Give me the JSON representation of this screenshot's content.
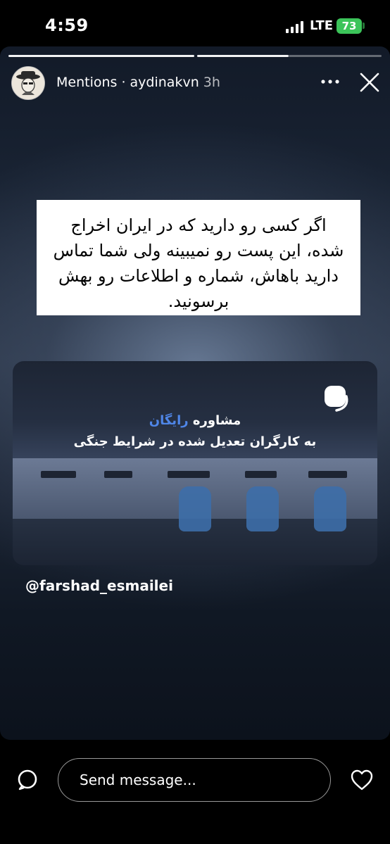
{
  "status_bar": {
    "time": "4:59",
    "network": "LTE",
    "battery": "73"
  },
  "story": {
    "header": {
      "label": "Mentions · aydinakvn",
      "time": "3h"
    },
    "text_card": {
      "text": "اگر کسی رو دارید که در ایران اخراج شده، این پست رو نمیبینه ولی شما تماس دارید باهاش، شماره و اطلاعات رو بهش برسونید."
    },
    "media_card": {
      "line1_prefix": "مشاوره ",
      "line1_highlight": "رایگان",
      "line2": "به کارگران تعدیل شده در شرایط جنگی"
    },
    "mention": "@farshad_esmailei"
  },
  "reply_bar": {
    "placeholder": "Send message..."
  },
  "colors": {
    "battery": "#3cc45a",
    "highlight": "#4f86e8"
  },
  "icons": [
    "signal-icon",
    "search-icon",
    "heart-icon",
    "close-icon",
    "more-icon"
  ]
}
